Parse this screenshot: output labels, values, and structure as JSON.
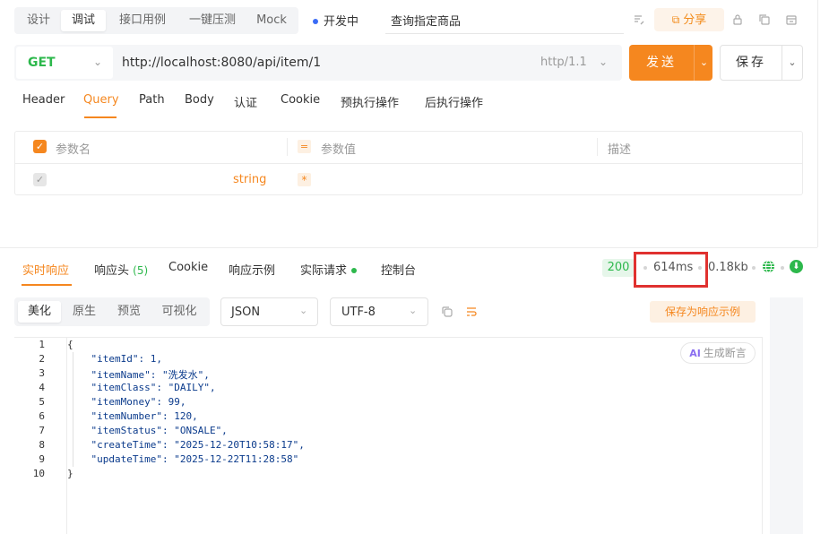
{
  "top_tabs": [
    "设计",
    "调试",
    "接口用例",
    "一键压测",
    "Mock"
  ],
  "active_top_tab": "调试",
  "environment": "开发中",
  "api_name": "查询指定商品",
  "share_label": "分享",
  "request": {
    "method": "GET",
    "url": "http://localhost:8080/api/item/1",
    "http_version": "http/1.1",
    "send_label": "发送",
    "save_label": "保存"
  },
  "request_tabs": [
    "Header",
    "Query",
    "Path",
    "Body",
    "认证",
    "Cookie",
    "预执行操作",
    "后执行操作"
  ],
  "active_request_tab": "Query",
  "params": {
    "headers": {
      "name": "参数名",
      "value": "参数值",
      "desc": "描述"
    },
    "row": {
      "type": "string",
      "required_mark": "*"
    }
  },
  "response_tabs": {
    "realtime": "实时响应",
    "headers": "响应头",
    "headers_count": "(5)",
    "cookie": "Cookie",
    "example": "响应示例",
    "actual_request": "实际请求",
    "console": "控制台"
  },
  "response_meta": {
    "status": "200",
    "time": "614ms",
    "size": "0.18kb"
  },
  "format_tabs": [
    "美化",
    "原生",
    "预览",
    "可视化"
  ],
  "active_format_tab": "美化",
  "response_type": "JSON",
  "encoding": "UTF-8",
  "save_example_label": "保存为响应示例",
  "ai_assert_label": "生成断言",
  "ai_tag": "AI",
  "line_numbers": [
    "1",
    "2",
    "3",
    "4",
    "5",
    "6",
    "7",
    "8",
    "9",
    "10"
  ],
  "code_lines": [
    "{",
    "    \"itemId\": 1,",
    "    \"itemName\": \"洗发水\",",
    "    \"itemClass\": \"DAILY\",",
    "    \"itemMoney\": 99,",
    "    \"itemNumber\": 120,",
    "    \"itemStatus\": \"ONSALE\",",
    "    \"createTime\": \"2025-12-20T10:58:17\",",
    "    \"updateTime\": \"2025-12-22T11:28:58\"",
    "}"
  ],
  "colors": {
    "accent": "#f5871f",
    "success": "#2db84c",
    "highlight": "#e0312f"
  }
}
